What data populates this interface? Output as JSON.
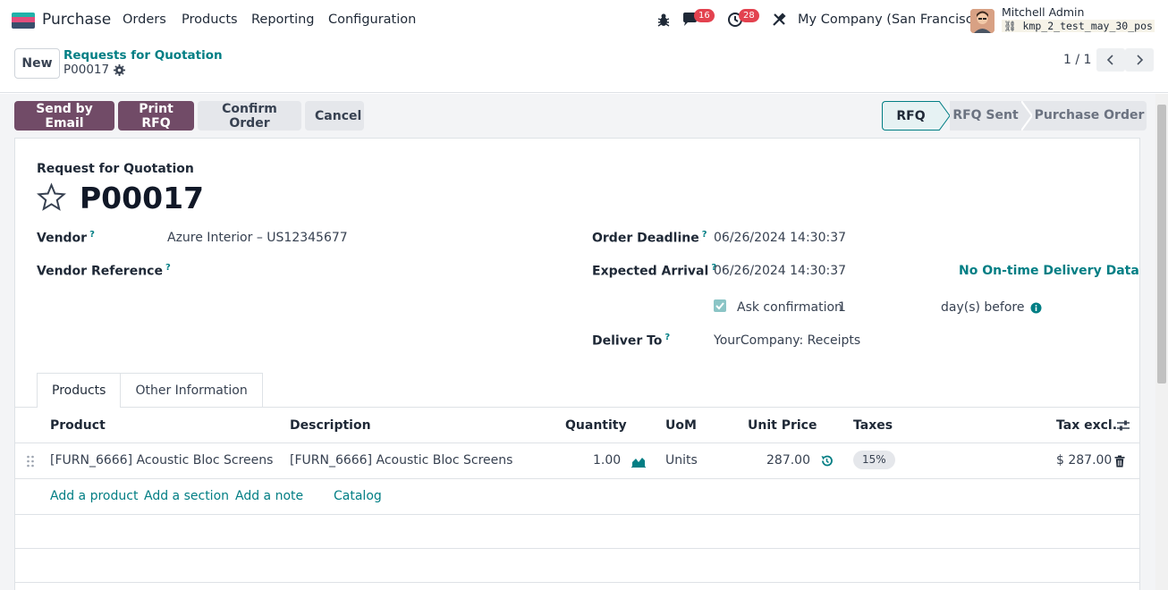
{
  "navbar": {
    "app_name": "Purchase",
    "menu": [
      "Orders",
      "Products",
      "Reporting",
      "Configuration"
    ],
    "chat_count": "16",
    "activity_count": "28",
    "company": "My Company (San Francisco)",
    "user_name": "Mitchell Admin",
    "database": "kmp_2_test_may_30_pos"
  },
  "control_panel": {
    "new_label": "New",
    "breadcrumb": "Requests for Quotation",
    "record": "P00017",
    "pager": "1 / 1"
  },
  "actions": {
    "send_email": "Send by Email",
    "print_rfq": "Print RFQ",
    "confirm": "Confirm Order",
    "cancel": "Cancel"
  },
  "statusbar": [
    "RFQ",
    "RFQ Sent",
    "Purchase Order"
  ],
  "form": {
    "subtitle": "Request for Quotation",
    "reference": "P00017",
    "vendor_label": "Vendor",
    "vendor_value": "Azure Interior – US12345677",
    "vendor_ref_label": "Vendor Reference",
    "deadline_label": "Order Deadline",
    "deadline_value": "06/26/2024 14:30:37",
    "arrival_label": "Expected Arrival",
    "arrival_value": "06/26/2024 14:30:37",
    "ontime_link": "No On-time Delivery Data",
    "ask_confirmation_label": "Ask confirmation",
    "ask_confirmation_days": "1",
    "days_before": "day(s) before",
    "deliver_to_label": "Deliver To",
    "deliver_to_value": "YourCompany: Receipts",
    "help_marker": "?"
  },
  "tabs": [
    "Products",
    "Other Information"
  ],
  "table": {
    "headers": {
      "product": "Product",
      "description": "Description",
      "quantity": "Quantity",
      "uom": "UoM",
      "unit_price": "Unit Price",
      "taxes": "Taxes",
      "tax_excl": "Tax excl."
    },
    "row": {
      "product": "[FURN_6666] Acoustic Bloc Screens",
      "description": "[FURN_6666] Acoustic Bloc Screens",
      "quantity": "1.00",
      "uom": "Units",
      "unit_price": "287.00",
      "taxes": "15%",
      "subtotal": "$ 287.00"
    },
    "add_links": {
      "add_product": "Add a product",
      "add_section": "Add a section",
      "add_note": "Add a note",
      "catalog": "Catalog"
    }
  },
  "colors": {
    "primary": "#714b67",
    "accent": "#017e84",
    "badge": "#e3424f"
  }
}
